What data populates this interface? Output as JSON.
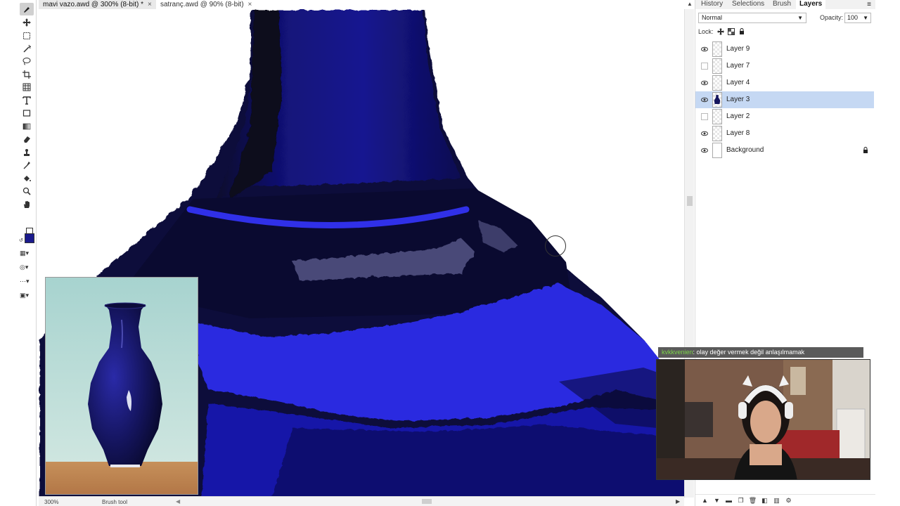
{
  "tabs": [
    {
      "label": "mavi vazo.awd @ 300% (8-bit) *",
      "close": "×",
      "active": true
    },
    {
      "label": "satranç.awd @ 90% (8-bit)",
      "close": "×",
      "active": false
    }
  ],
  "toolbar": {
    "tools": [
      "brush-icon",
      "move-icon",
      "marquee-icon",
      "magic-wand-icon",
      "lasso-icon",
      "crop-icon",
      "grid-icon",
      "text-icon",
      "shape-icon",
      "gradient-icon",
      "eraser-icon",
      "stamp-icon",
      "eyedropper-icon",
      "fill-icon",
      "zoom-icon",
      "hand-icon"
    ],
    "foreground_color": "#1a1a8c",
    "background_color": "#ffffff"
  },
  "status": {
    "zoom": "300%",
    "tool": "Brush tool"
  },
  "panel": {
    "tabs": [
      "History",
      "Selections",
      "Brush",
      "Layers"
    ],
    "active_tab": "Layers",
    "blend_mode": "Normal",
    "opacity_label": "Opacity:",
    "opacity_value": "100",
    "lock_label": "Lock:",
    "layers": [
      {
        "name": "Layer 9",
        "visible": true,
        "selected": false
      },
      {
        "name": "Layer 7",
        "visible": false,
        "selected": false
      },
      {
        "name": "Layer 4",
        "visible": true,
        "selected": false
      },
      {
        "name": "Layer 3",
        "visible": true,
        "selected": true
      },
      {
        "name": "Layer 2",
        "visible": false,
        "selected": false
      },
      {
        "name": "Layer 8",
        "visible": true,
        "selected": false
      },
      {
        "name": "Background",
        "visible": true,
        "selected": false,
        "locked": true
      }
    ]
  },
  "stream": {
    "chat_user": "kvkkvenien",
    "chat_message": ": olay değer vermek değil anlaşılmamak"
  },
  "colors": {
    "vase_dark": "#0a0a3a",
    "vase_mid": "#14148a",
    "vase_bright": "#2a2ae0",
    "highlight_gray": "#4a4a78",
    "selected_layer": "#c5d8f3"
  }
}
